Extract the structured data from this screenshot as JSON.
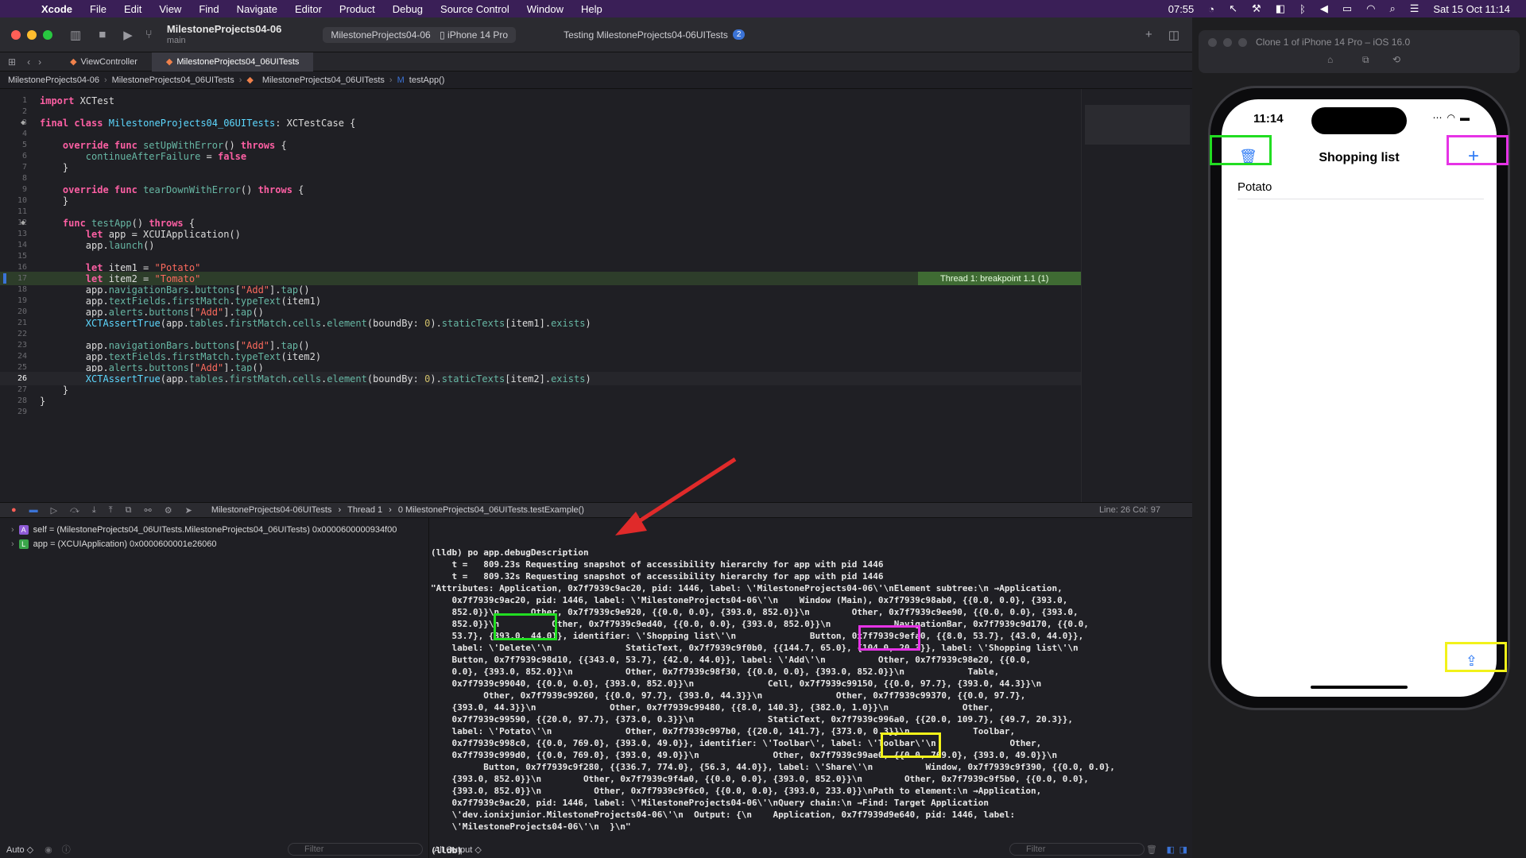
{
  "menubar": {
    "items": [
      "Xcode",
      "File",
      "Edit",
      "View",
      "Find",
      "Navigate",
      "Editor",
      "Product",
      "Debug",
      "Source Control",
      "Window",
      "Help"
    ],
    "time_small": "07:55",
    "date": "Sat 15 Oct 11:14"
  },
  "toolbar": {
    "project": "MilestoneProjects04-06",
    "branch": "main",
    "scheme": "MilestoneProjects04-06",
    "device": "iPhone 14 Pro",
    "status": "Testing MilestoneProjects04-06UITests",
    "badge": "2"
  },
  "tabs": [
    "ViewController",
    "MilestoneProjects04_06UITests"
  ],
  "jumpbar": [
    "MilestoneProjects04-06",
    "MilestoneProjects04_06UITests",
    "MilestoneProjects04_06UITests",
    "testApp()"
  ],
  "editor": {
    "breakpoint_label": "Thread 1: breakpoint 1.1 (1)",
    "line_numbers": [
      "1",
      "2",
      "3",
      "4",
      "5",
      "6",
      "7",
      "8",
      "9",
      "10",
      "11",
      "12",
      "13",
      "14",
      "15",
      "16",
      "17",
      "18",
      "19",
      "20",
      "21",
      "22",
      "23",
      "24",
      "25",
      "26",
      "27",
      "28",
      "29"
    ]
  },
  "debugbar": {
    "crumbs": [
      "MilestoneProjects04-06UITests",
      "Thread 1",
      "0 MilestoneProjects04_06UITests.testExample()"
    ],
    "line_col": "Line: 26  Col: 97"
  },
  "variables": [
    {
      "tag": "A",
      "text": "self = (MilestoneProjects04_06UITests.MilestoneProjects04_06UITests) 0x0000600000934f00"
    },
    {
      "tag": "L",
      "text": "app = (XCUIApplication) 0x0000600001e26060"
    }
  ],
  "vars_bottom": {
    "mode": "Auto ◇",
    "filter_placeholder": "Filter"
  },
  "console": {
    "lines": [
      "(lldb) po app.debugDescription",
      "    t =   809.23s Requesting snapshot of accessibility hierarchy for app with pid 1446",
      "    t =   809.32s Requesting snapshot of accessibility hierarchy for app with pid 1446",
      "\"Attributes: Application, 0x7f7939c9ac20, pid: 1446, label: \\'MilestoneProjects04-06\\'\\nElement subtree:\\n →Application,",
      "    0x7f7939c9ac20, pid: 1446, label: \\'MilestoneProjects04-06\\'\\n    Window (Main), 0x7f7939c98ab0, {{0.0, 0.0}, {393.0,",
      "    852.0}}\\n      Other, 0x7f7939c9e920, {{0.0, 0.0}, {393.0, 852.0}}\\n        Other, 0x7f7939c9ee90, {{0.0, 0.0}, {393.0,",
      "    852.0}}\\n          Other, 0x7f7939c9ed40, {{0.0, 0.0}, {393.0, 852.0}}\\n            NavigationBar, 0x7f7939c9d170, {{0.0,",
      "    53.7}, {393.0, 44.0}}, identifier: \\'Shopping list\\'\\n              Button, 0x7f7939c9efa0, {{8.0, 53.7}, {43.0, 44.0}},",
      "    label: \\'Delete\\'\\n              StaticText, 0x7f7939c9f0b0, {{144.7, 65.0}, {104.0, 20.3}}, label: \\'Shopping list\\'\\n",
      "    Button, 0x7f7939c98d10, {{343.0, 53.7}, {42.0, 44.0}}, label: \\'Add\\'\\n          Other, 0x7f7939c98e20, {{0.0,",
      "    0.0}, {393.0, 852.0}}\\n          Other, 0x7f7939c98f30, {{0.0, 0.0}, {393.0, 852.0}}\\n            Table,",
      "    0x7f7939c99040, {{0.0, 0.0}, {393.0, 852.0}}\\n              Cell, 0x7f7939c99150, {{0.0, 97.7}, {393.0, 44.3}}\\n",
      "          Other, 0x7f7939c99260, {{0.0, 97.7}, {393.0, 44.3}}\\n              Other, 0x7f7939c99370, {{0.0, 97.7},",
      "    {393.0, 44.3}}\\n              Other, 0x7f7939c99480, {{8.0, 140.3}, {382.0, 1.0}}\\n              Other,",
      "    0x7f7939c99590, {{20.0, 97.7}, {373.0, 0.3}}\\n              StaticText, 0x7f7939c996a0, {{20.0, 109.7}, {49.7, 20.3}},",
      "    label: \\'Potato\\'\\n              Other, 0x7f7939c997b0, {{20.0, 141.7}, {373.0, 0.3}}\\n            Toolbar,",
      "    0x7f7939c998c0, {{0.0, 769.0}, {393.0, 49.0}}, identifier: \\'Toolbar\\', label: \\'Toolbar\\'\\n              Other,",
      "    0x7f7939c999d0, {{0.0, 769.0}, {393.0, 49.0}}\\n              Other, 0x7f7939c99ae0, {{0.0, 769.0}, {393.0, 49.0}}\\n",
      "          Button, 0x7f7939c9f280, {{336.7, 774.0}, {56.3, 44.0}}, label: \\'Share\\'\\n          Window, 0x7f7939c9f390, {{0.0, 0.0},",
      "    {393.0, 852.0}}\\n        Other, 0x7f7939c9f4a0, {{0.0, 0.0}, {393.0, 852.0}}\\n        Other, 0x7f7939c9f5b0, {{0.0, 0.0},",
      "    {393.0, 852.0}}\\n          Other, 0x7f7939c9f6c0, {{0.0, 0.0}, {393.0, 233.0}}\\nPath to element:\\n →Application,",
      "    0x7f7939c9ac20, pid: 1446, label: \\'MilestoneProjects04-06\\'\\nQuery chain:\\n →Find: Target Application",
      "    \\'dev.ionixjunior.MilestoneProjects04-06\\'\\n  Output: {\\n    Application, 0x7f7939d9e640, pid: 1446, label:",
      "    \\'MilestoneProjects04-06\\'\\n  }\\n\"",
      "",
      "(lldb)"
    ],
    "output_mode": "All Output ◇",
    "filter_placeholder": "Filter"
  },
  "simulator": {
    "title": "Clone 1 of iPhone 14 Pro – iOS 16.0",
    "time": "11:14",
    "nav_title": "Shopping list",
    "rows": [
      "Potato"
    ]
  },
  "colors": {
    "highlight_green": "#22dd22",
    "highlight_magenta": "#e633e6",
    "highlight_yellow": "#f2f21a",
    "arrow_red": "#e02a2a"
  }
}
